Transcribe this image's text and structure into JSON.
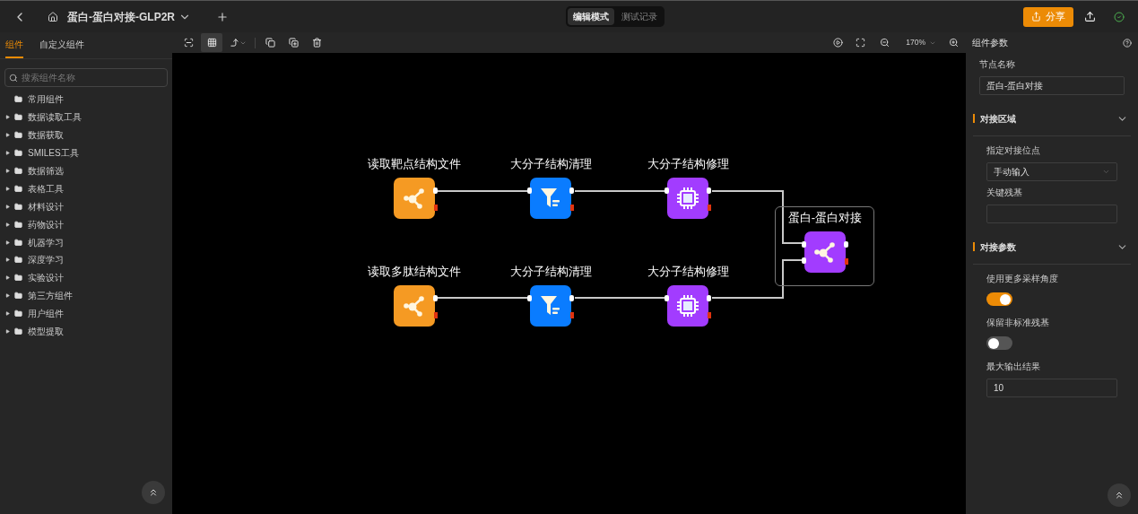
{
  "header": {
    "title": "蛋白-蛋白对接-GLP2R",
    "modes": [
      {
        "label": "编辑模式",
        "selected": true
      },
      {
        "label": "测试记录",
        "selected": false
      }
    ],
    "share_button": "分享"
  },
  "sidebar": {
    "tabs": [
      {
        "label": "组件",
        "selected": true
      },
      {
        "label": "自定义组件",
        "selected": false
      }
    ],
    "search": {
      "placeholder": "搜索组件名称"
    },
    "items": [
      {
        "label": "常用组件",
        "expandable": false
      },
      {
        "label": "数据读取工具",
        "expandable": true
      },
      {
        "label": "数据获取",
        "expandable": true
      },
      {
        "label": "SMILES工具",
        "expandable": true
      },
      {
        "label": "数据筛选",
        "expandable": true
      },
      {
        "label": "表格工具",
        "expandable": true
      },
      {
        "label": "材料设计",
        "expandable": true
      },
      {
        "label": "药物设计",
        "expandable": true
      },
      {
        "label": "机器学习",
        "expandable": true
      },
      {
        "label": "深度学习",
        "expandable": true
      },
      {
        "label": "实验设计",
        "expandable": true
      },
      {
        "label": "第三方组件",
        "expandable": true
      },
      {
        "label": "用户组件",
        "expandable": true
      },
      {
        "label": "模型提取",
        "expandable": true
      }
    ]
  },
  "toolbar": {
    "tools": [
      {
        "kind": "select",
        "selected": false
      },
      {
        "kind": "grid",
        "selected": true
      },
      {
        "kind": "connector",
        "selected": false
      },
      {
        "kind": "copy",
        "selected": false
      },
      {
        "kind": "duplicate",
        "selected": false
      },
      {
        "kind": "delete",
        "selected": false
      }
    ],
    "zoom": "170%"
  },
  "canvas": {
    "nodes": [
      {
        "label": "读取靶点结构文件",
        "kind": "reader",
        "color": "#f59a23",
        "selected": false
      },
      {
        "label": "大分子结构清理",
        "kind": "filter",
        "color": "#0a7cff",
        "selected": false
      },
      {
        "label": "大分子结构修理",
        "kind": "chip",
        "color": "#a23cff",
        "selected": false
      },
      {
        "label": "读取多肽结构文件",
        "kind": "reader",
        "color": "#f59a23",
        "selected": false
      },
      {
        "label": "大分子结构清理",
        "kind": "filter",
        "color": "#0a7cff",
        "selected": false
      },
      {
        "label": "大分子结构修理",
        "kind": "chip",
        "color": "#a23cff",
        "selected": false
      },
      {
        "label": "蛋白-蛋白对接",
        "kind": "docking",
        "color": "#a23cff",
        "selected": true
      }
    ]
  },
  "panel": {
    "title": "组件参数",
    "node_name": {
      "label": "节点名称",
      "value": "蛋白-蛋白对接"
    },
    "sections": [
      {
        "title": "对接区域",
        "expanded": true,
        "fields": [
          {
            "kind": "select",
            "label": "指定对接位点",
            "value": "手动输入"
          },
          {
            "kind": "text",
            "label": "关键残基"
          }
        ]
      },
      {
        "title": "对接参数",
        "expanded": true,
        "fields": [
          {
            "kind": "toggle",
            "label": "使用更多采样角度",
            "on": true
          },
          {
            "kind": "toggle",
            "label": "保留非标准残基",
            "on": false
          },
          {
            "kind": "text",
            "label": "最大输出结果",
            "value": "10"
          }
        ]
      }
    ]
  }
}
